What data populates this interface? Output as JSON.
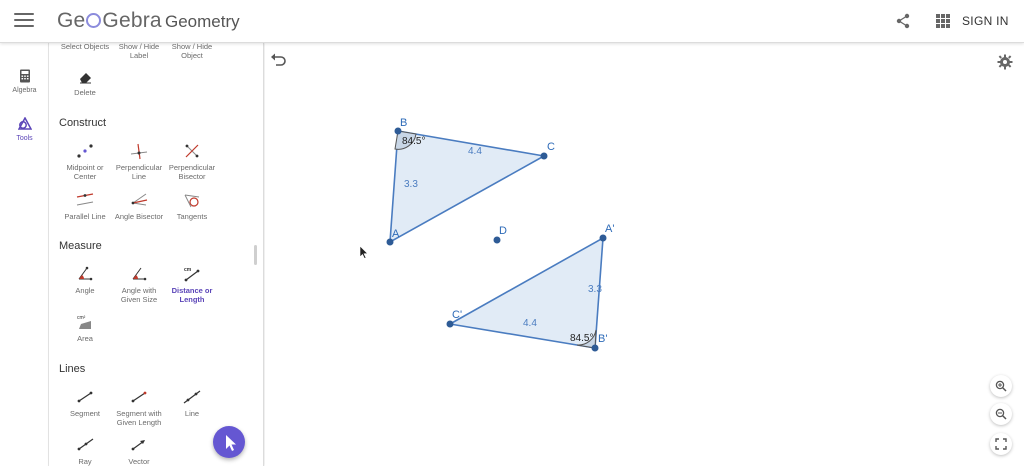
{
  "header": {
    "logo": "GeoGebra",
    "logo_parts": [
      "Ge",
      "Gebra"
    ],
    "app_title": "Geometry",
    "sign_in": "SIGN IN",
    "icons": [
      "menu-icon",
      "share-icon",
      "apps-icon"
    ]
  },
  "rail": {
    "items": [
      {
        "label": "Algebra",
        "icon": "calculator-icon"
      },
      {
        "label": "Tools",
        "icon": "tools-icon"
      }
    ]
  },
  "tools": {
    "top_row": [
      "Select Objects",
      "Show / Hide Label",
      "Show / Hide Object"
    ],
    "top_row_lines": [
      [
        "Select Objects"
      ],
      [
        "Show / Hide",
        "Label"
      ],
      [
        "Show / Hide",
        "Object"
      ]
    ],
    "delete": "Delete",
    "sections": {
      "construct": {
        "title": "Construct",
        "items": [
          {
            "label": [
              "Midpoint or",
              "Center"
            ]
          },
          {
            "label": [
              "Perpendicular",
              "Line"
            ]
          },
          {
            "label": [
              "Perpendicular",
              "Bisector"
            ]
          },
          {
            "label": [
              "Parallel Line"
            ]
          },
          {
            "label": [
              "Angle Bisector"
            ]
          },
          {
            "label": [
              "Tangents"
            ]
          }
        ]
      },
      "measure": {
        "title": "Measure",
        "items": [
          {
            "label": [
              "Angle"
            ]
          },
          {
            "label": [
              "Angle with",
              "Given Size"
            ]
          },
          {
            "label": [
              "Distance or",
              "Length"
            ],
            "active": true
          },
          {
            "label": [
              "Area"
            ]
          }
        ]
      },
      "lines": {
        "title": "Lines",
        "items": [
          {
            "label": [
              "Segment"
            ]
          },
          {
            "label": [
              "Segment with",
              "Given Length"
            ]
          },
          {
            "label": [
              "Line"
            ]
          },
          {
            "label": [
              "Ray"
            ]
          },
          {
            "label": [
              "Vector"
            ]
          }
        ]
      }
    },
    "icon_glyphs": {
      "cm": "cm",
      "area": "cm²"
    }
  },
  "graphics": {
    "points": {
      "A": "A",
      "B": "B",
      "C": "C",
      "D": "D",
      "A1": "A'",
      "B1": "B'",
      "C1": "C'"
    },
    "triangle1": {
      "angle_B": "84.5°",
      "side_BC": "4.4",
      "side_AB": "3.3"
    },
    "triangle2": {
      "angle_B": "84.5°",
      "side_CB": "4.4",
      "side_AB": "3.3"
    },
    "accent_color": "#4a7cc0",
    "fill_color": "#dce8f5"
  }
}
